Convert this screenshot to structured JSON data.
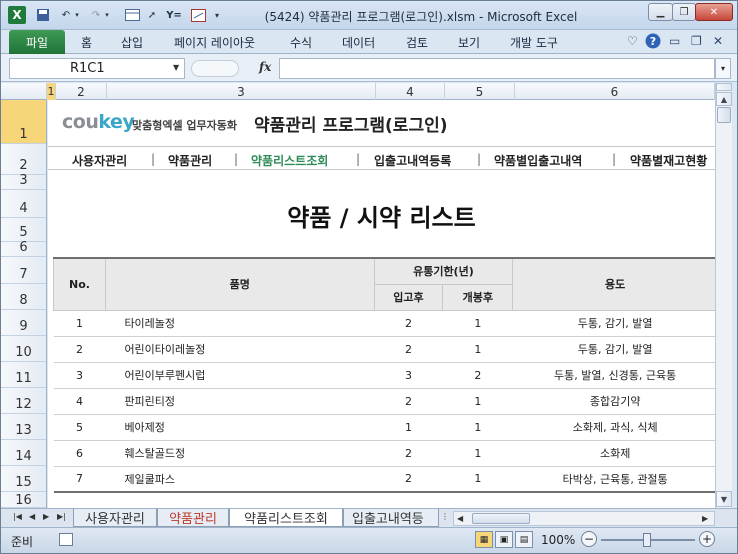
{
  "window": {
    "app_icon": "X",
    "title": "(5424) 약품관리 프로그램(로그인).xlsm  -  Microsoft Excel",
    "qat_icons": [
      "save-icon",
      "undo-icon",
      "redo-icon",
      "form-icon",
      "select-icon",
      "filter-icon",
      "chart-icon",
      "dropdown-icon"
    ]
  },
  "ribbon": {
    "file_tab": "파일",
    "tabs": [
      "홈",
      "삽입",
      "페이지 레이아웃",
      "수식",
      "데이터",
      "검토",
      "보기",
      "개발 도구"
    ]
  },
  "formula_bar": {
    "name_box": "R1C1",
    "fx": "fx",
    "value": ""
  },
  "columns": [
    "1",
    "2",
    "3",
    "4",
    "5",
    "6"
  ],
  "rows": [
    "1",
    "2",
    "3",
    "4",
    "5",
    "6",
    "7",
    "8",
    "9",
    "10",
    "11",
    "12",
    "13",
    "14",
    "15",
    "16"
  ],
  "sheet": {
    "logo_main": "cou",
    "logo_accent": "key",
    "logo_tagline": "맞춤형엑셀 업무자동화",
    "program_title": "약품관리 프로그램(로그인)",
    "nav": [
      "사용자관리",
      "약품관리",
      "약품리스트조회",
      "입출고내역등록",
      "약품별입출고내역",
      "약품별재고현황"
    ],
    "nav_active_color": "#2e8b57",
    "page_title": "약품 / 시약 리스트",
    "table": {
      "headers": {
        "no": "No.",
        "name": "품명",
        "expiry": "유통기한(년)",
        "after_stock": "입고후",
        "after_open": "개봉후",
        "usage": "용도"
      },
      "rows": [
        {
          "no": "1",
          "name": "타이레놀정",
          "after_stock": "2",
          "after_open": "1",
          "usage": "두통, 감기, 발열"
        },
        {
          "no": "2",
          "name": "어린이타이레놀정",
          "after_stock": "2",
          "after_open": "1",
          "usage": "두통, 감기, 발열"
        },
        {
          "no": "3",
          "name": "어린이부루펜시럽",
          "after_stock": "3",
          "after_open": "2",
          "usage": "두통, 발열, 신경통, 근육통"
        },
        {
          "no": "4",
          "name": "판피린티정",
          "after_stock": "2",
          "after_open": "1",
          "usage": "종합감기약"
        },
        {
          "no": "5",
          "name": "베아제정",
          "after_stock": "1",
          "after_open": "1",
          "usage": "소화제, 과식, 식체"
        },
        {
          "no": "6",
          "name": "훼스탈골드정",
          "after_stock": "2",
          "after_open": "1",
          "usage": "소화제"
        },
        {
          "no": "7",
          "name": "제일쿨파스",
          "after_stock": "2",
          "after_open": "1",
          "usage": "타박상, 근육통, 관절통"
        }
      ]
    }
  },
  "sheet_tabs": [
    "사용자관리",
    "약품관리",
    "약품리스트조회",
    "입출고내역등"
  ],
  "status": {
    "ready": "준비",
    "zoom": "100%"
  }
}
